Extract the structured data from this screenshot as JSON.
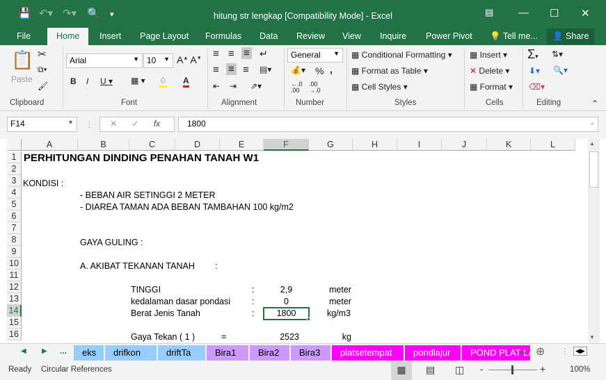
{
  "title": "hitung str lengkap  [Compatibility Mode] - Excel",
  "tabs": [
    "File",
    "Home",
    "Insert",
    "Page Layout",
    "Formulas",
    "Data",
    "Review",
    "View",
    "Inquire",
    "Power Pivot",
    "Tell me...",
    "Share"
  ],
  "ribbon": {
    "paste": "Paste",
    "font": "Arial",
    "size": "10",
    "number_format": "General",
    "conditional": "Conditional Formatting",
    "format_table": "Format as Table",
    "cell_styles": "Cell Styles",
    "insert": "Insert",
    "delete": "Delete",
    "format": "Format",
    "groups": [
      "Clipboard",
      "Font",
      "Alignment",
      "Number",
      "Styles",
      "Cells",
      "Editing"
    ]
  },
  "formula_bar": {
    "name_box": "F14",
    "formula": "1800"
  },
  "columns": [
    "A",
    "B",
    "C",
    "D",
    "E",
    "F",
    "G",
    "H",
    "I",
    "J",
    "K",
    "L"
  ],
  "rows": [
    "1",
    "2",
    "3",
    "4",
    "5",
    "6",
    "7",
    "8",
    "9",
    "10",
    "11",
    "12",
    "13",
    "14",
    "15",
    "16"
  ],
  "cells": {
    "r1": "PERHITUNGAN DINDING PENAHAN TANAH W1",
    "r3": "KONDISI :",
    "r4": "- BEBAN AIR SETINGGI 2 METER",
    "r5": "- DIAREA TAMAN ADA BEBAN TAMBAHAN 100 kg/m2",
    "r8": "GAYA GULING :",
    "r10a": "A. AKIBAT TEKANAN  TANAH",
    "r10b": ":",
    "r12": {
      "label": "TINGGI",
      "colon": ":",
      "value": "2,9",
      "unit": "meter"
    },
    "r13": {
      "label": "kedalaman dasar pondasi",
      "colon": ":",
      "value": "0",
      "unit": "meter"
    },
    "r14": {
      "label": "Berat Jenis Tanah",
      "colon": ":",
      "value": "1800",
      "unit": "kg/m3"
    },
    "r16": {
      "label": "Gaya Tekan ( 1 )",
      "eq": "=",
      "value": "2523",
      "unit": "kg"
    }
  },
  "sheets": [
    {
      "name": "eks",
      "color": "#99ccff",
      "text": "#000"
    },
    {
      "name": "drifkon",
      "color": "#99ccff",
      "text": "#000"
    },
    {
      "name": "driftTa",
      "color": "#99ccff",
      "text": "#000"
    },
    {
      "name": "Bira1",
      "color": "#cc99ff",
      "text": "#000"
    },
    {
      "name": "Bira2",
      "color": "#cc99ff",
      "text": "#000"
    },
    {
      "name": "Bira3",
      "color": "#cc99ff",
      "text": "#000"
    },
    {
      "name": "platsetempat",
      "color": "#ff00ff",
      "text": "#fff"
    },
    {
      "name": "pondlajur",
      "color": "#ff00ff",
      "text": "#fff"
    },
    {
      "name": "POND PLAT LA",
      "color": "#ff00ff",
      "text": "#fff"
    }
  ],
  "status": {
    "ready": "Ready",
    "circular": "Circular References",
    "zoom": "100%"
  },
  "accent": "#217346"
}
